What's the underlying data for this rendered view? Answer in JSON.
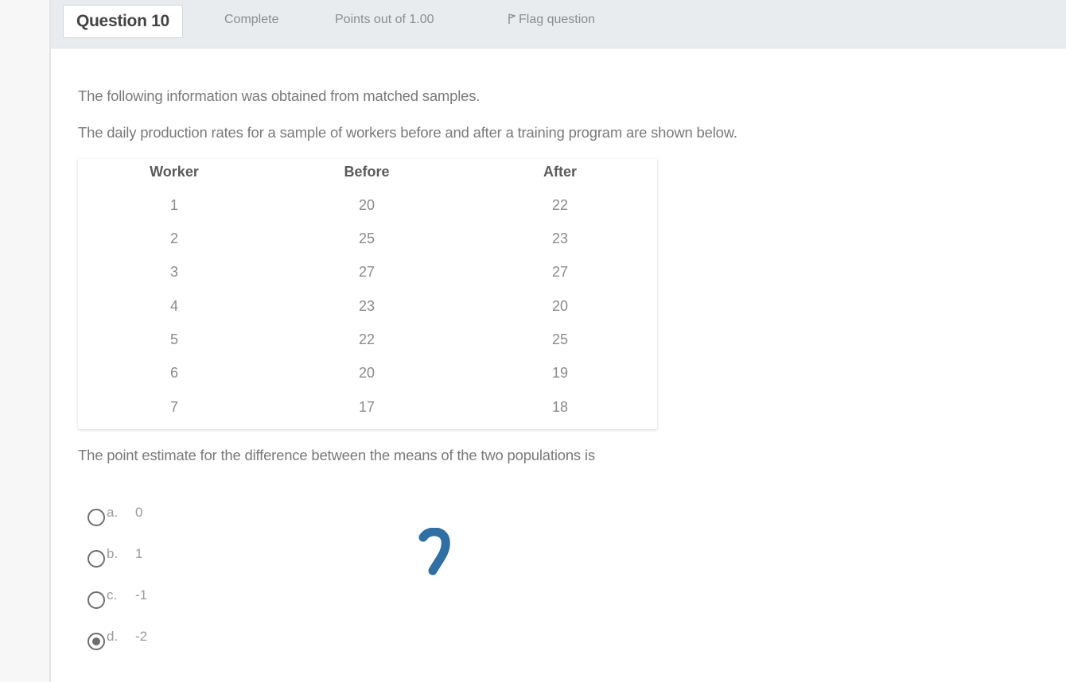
{
  "question": {
    "title": "Question 10",
    "status": "Complete",
    "points": "Points out of 1.00",
    "flag_label": "Flag question"
  },
  "intro": [
    "The following information was obtained from matched samples.",
    "The daily production rates for a sample of workers before and after a training program are shown below."
  ],
  "table": {
    "headers": [
      "Worker",
      "Before",
      "After"
    ],
    "rows": [
      [
        "1",
        "20",
        "22"
      ],
      [
        "2",
        "25",
        "23"
      ],
      [
        "3",
        "27",
        "27"
      ],
      [
        "4",
        "23",
        "20"
      ],
      [
        "5",
        "22",
        "25"
      ],
      [
        "6",
        "20",
        "19"
      ],
      [
        "7",
        "17",
        "18"
      ]
    ]
  },
  "prompt": "The point estimate for the difference between the means of the two populations is",
  "options": [
    {
      "letter": "a.",
      "text": "0",
      "checked": false
    },
    {
      "letter": "b.",
      "text": "1",
      "checked": false
    },
    {
      "letter": "c.",
      "text": "-1",
      "checked": false
    },
    {
      "letter": "d.",
      "text": "-2",
      "checked": true
    }
  ],
  "icons": {
    "flag": "flag-icon"
  },
  "colors": {
    "annotation_ink": "#2f6fa3"
  }
}
